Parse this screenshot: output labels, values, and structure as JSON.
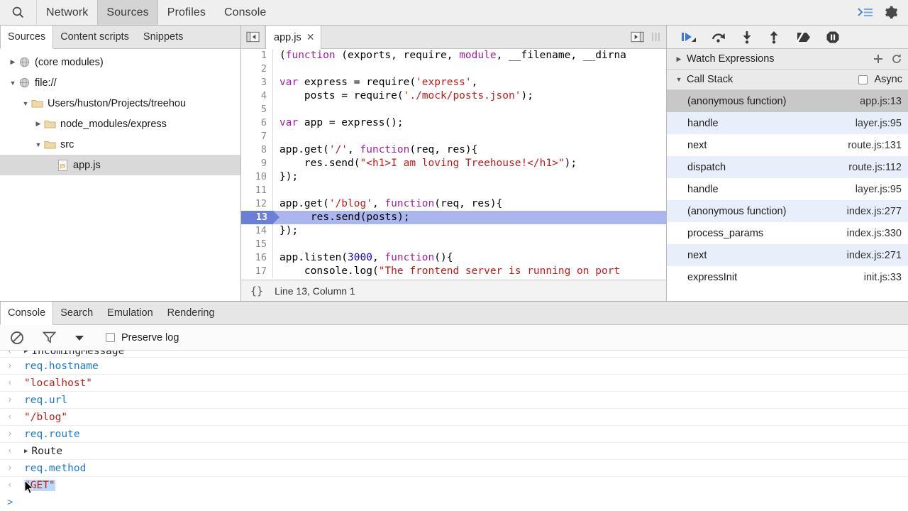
{
  "topbar": {
    "search_icon": "search-icon",
    "tabs": [
      {
        "label": "Network",
        "selected": false
      },
      {
        "label": "Sources",
        "selected": true
      },
      {
        "label": "Profiles",
        "selected": false
      },
      {
        "label": "Console",
        "selected": false
      }
    ],
    "drawer_toggle_icon": "console-drawer-icon",
    "settings_icon": "gear-icon"
  },
  "navigator": {
    "tabs": [
      {
        "label": "Sources",
        "selected": true
      },
      {
        "label": "Content scripts",
        "selected": false
      },
      {
        "label": "Snippets",
        "selected": false
      }
    ],
    "tree": [
      {
        "label": "(core modules)",
        "indent": 0,
        "twisty": "collapsed",
        "icon": "globe-icon",
        "selected": false
      },
      {
        "label": "file://",
        "indent": 0,
        "twisty": "expanded",
        "icon": "globe-icon",
        "selected": false
      },
      {
        "label": "Users/huston/Projects/treehou",
        "indent": 1,
        "twisty": "expanded",
        "icon": "folder-icon",
        "selected": false
      },
      {
        "label": "node_modules/express",
        "indent": 2,
        "twisty": "collapsed",
        "icon": "folder-icon",
        "selected": false
      },
      {
        "label": "src",
        "indent": 2,
        "twisty": "expanded",
        "icon": "folder-icon",
        "selected": false
      },
      {
        "label": "app.js",
        "indent": 3,
        "twisty": "none",
        "icon": "js-file-icon",
        "selected": true
      }
    ]
  },
  "editor": {
    "panel_toggle_icon": "collapse-sidebar-icon",
    "tab": {
      "label": "app.js",
      "close_icon": "close-icon"
    },
    "right_icons": [
      "show-navigator-icon",
      "more-options-icon"
    ],
    "status": {
      "pretty_print_label": "{}",
      "position": "Line 13, Column 1"
    },
    "execution_line": 13,
    "lines": [
      {
        "n": 1,
        "tokens": [
          {
            "t": "(",
            "c": "pln"
          },
          {
            "t": "function",
            "c": "kw"
          },
          {
            "t": " (exports, require, ",
            "c": "pln"
          },
          {
            "t": "module",
            "c": "kw"
          },
          {
            "t": ", __filename, __dirna",
            "c": "pln"
          }
        ]
      },
      {
        "n": 2,
        "tokens": []
      },
      {
        "n": 3,
        "tokens": [
          {
            "t": "var",
            "c": "kw"
          },
          {
            "t": " express = require(",
            "c": "pln"
          },
          {
            "t": "'express'",
            "c": "str"
          },
          {
            "t": ",",
            "c": "pln"
          }
        ]
      },
      {
        "n": 4,
        "tokens": [
          {
            "t": "    posts = require(",
            "c": "pln"
          },
          {
            "t": "'./mock/posts.json'",
            "c": "str"
          },
          {
            "t": ");",
            "c": "pln"
          }
        ]
      },
      {
        "n": 5,
        "tokens": []
      },
      {
        "n": 6,
        "tokens": [
          {
            "t": "var",
            "c": "kw"
          },
          {
            "t": " app = express();",
            "c": "pln"
          }
        ]
      },
      {
        "n": 7,
        "tokens": []
      },
      {
        "n": 8,
        "tokens": [
          {
            "t": "app.get(",
            "c": "pln"
          },
          {
            "t": "'/'",
            "c": "str"
          },
          {
            "t": ", ",
            "c": "pln"
          },
          {
            "t": "function",
            "c": "kw"
          },
          {
            "t": "(req, res){",
            "c": "pln"
          }
        ]
      },
      {
        "n": 9,
        "tokens": [
          {
            "t": "    res.send(",
            "c": "pln"
          },
          {
            "t": "\"<h1>I am loving Treehouse!</h1>\"",
            "c": "str"
          },
          {
            "t": ");",
            "c": "pln"
          }
        ]
      },
      {
        "n": 10,
        "tokens": [
          {
            "t": "});",
            "c": "pln"
          }
        ]
      },
      {
        "n": 11,
        "tokens": []
      },
      {
        "n": 12,
        "tokens": [
          {
            "t": "app.get(",
            "c": "pln"
          },
          {
            "t": "'/blog'",
            "c": "str"
          },
          {
            "t": ", ",
            "c": "pln"
          },
          {
            "t": "function",
            "c": "kw"
          },
          {
            "t": "(req, res){",
            "c": "pln"
          }
        ]
      },
      {
        "n": 13,
        "tokens": [
          {
            "t": "    res.send(posts);",
            "c": "pln"
          }
        ]
      },
      {
        "n": 14,
        "tokens": [
          {
            "t": "});",
            "c": "pln"
          }
        ]
      },
      {
        "n": 15,
        "tokens": []
      },
      {
        "n": 16,
        "tokens": [
          {
            "t": "app.listen(",
            "c": "pln"
          },
          {
            "t": "3000",
            "c": "num"
          },
          {
            "t": ", ",
            "c": "pln"
          },
          {
            "t": "function",
            "c": "kw"
          },
          {
            "t": "(){",
            "c": "pln"
          }
        ]
      },
      {
        "n": 17,
        "tokens": [
          {
            "t": "    console.log(",
            "c": "pln"
          },
          {
            "t": "\"The frontend server is running on port",
            "c": "str"
          }
        ]
      }
    ]
  },
  "sidebar": {
    "debug_buttons": [
      {
        "name": "resume-script-execution",
        "icon": "resume-icon"
      },
      {
        "name": "step-over",
        "icon": "step-over-icon"
      },
      {
        "name": "step-into",
        "icon": "step-into-icon"
      },
      {
        "name": "step-out",
        "icon": "step-out-icon"
      },
      {
        "name": "deactivate-breakpoints",
        "icon": "deactivate-breakpoints-icon"
      },
      {
        "name": "pause-on-exceptions",
        "icon": "pause-on-exceptions-icon"
      }
    ],
    "watch": {
      "title": "Watch Expressions",
      "twisty": "collapsed",
      "add_icon": "plus-icon",
      "refresh_icon": "refresh-icon"
    },
    "call_stack": {
      "title": "Call Stack",
      "twisty": "expanded",
      "async_label": "Async",
      "async_checked": false,
      "frames": [
        {
          "name": "(anonymous function)",
          "location": "app.js:13",
          "selected": true
        },
        {
          "name": "handle",
          "location": "layer.js:95",
          "selected": false
        },
        {
          "name": "next",
          "location": "route.js:131",
          "selected": false
        },
        {
          "name": "dispatch",
          "location": "route.js:112",
          "selected": false
        },
        {
          "name": "handle",
          "location": "layer.js:95",
          "selected": false
        },
        {
          "name": "(anonymous function)",
          "location": "index.js:277",
          "selected": false
        },
        {
          "name": "process_params",
          "location": "index.js:330",
          "selected": false
        },
        {
          "name": "next",
          "location": "index.js:271",
          "selected": false
        },
        {
          "name": "expressInit",
          "location": "init.js:33",
          "selected": false
        }
      ]
    }
  },
  "drawer": {
    "tabs": [
      {
        "label": "Console",
        "selected": true
      },
      {
        "label": "Search",
        "selected": false
      },
      {
        "label": "Emulation",
        "selected": false
      },
      {
        "label": "Rendering",
        "selected": false
      }
    ],
    "toolbar": {
      "clear_icon": "clear-console-icon",
      "filter_icon": "filter-icon",
      "context_dropdown_icon": "chevron-down-icon",
      "preserve_log_label": "Preserve log",
      "preserve_log_checked": false
    },
    "console_entries": [
      {
        "kind": "output",
        "arrow": "inbound",
        "type": "object",
        "text": "IncomingMessage",
        "clipped": true
      },
      {
        "kind": "input",
        "arrow": "outbound",
        "type": "command",
        "text": "req.hostname"
      },
      {
        "kind": "output",
        "arrow": "inbound",
        "type": "string",
        "text": "\"localhost\""
      },
      {
        "kind": "input",
        "arrow": "outbound",
        "type": "command",
        "text": "req.url"
      },
      {
        "kind": "output",
        "arrow": "inbound",
        "type": "string",
        "text": "\"/blog\""
      },
      {
        "kind": "input",
        "arrow": "outbound",
        "type": "command",
        "text": "req.route"
      },
      {
        "kind": "output",
        "arrow": "inbound",
        "type": "object",
        "text": "Route"
      },
      {
        "kind": "input",
        "arrow": "outbound",
        "type": "command",
        "text": "req.method"
      },
      {
        "kind": "output",
        "arrow": "inbound",
        "type": "string",
        "text": "\"GET\"",
        "selected": true
      }
    ],
    "prompt": ">"
  },
  "colors": {
    "accent_blue": "#1a7ad4",
    "exec_line": "#aab6ed",
    "exec_gutter": "#6b7fd7",
    "string_red": "#c41a16",
    "keyword_purple": "#a020a0",
    "number_blue": "#1c00cf",
    "selection_blue": "#bcd9f7",
    "toolbar_grey": "#efefef"
  }
}
